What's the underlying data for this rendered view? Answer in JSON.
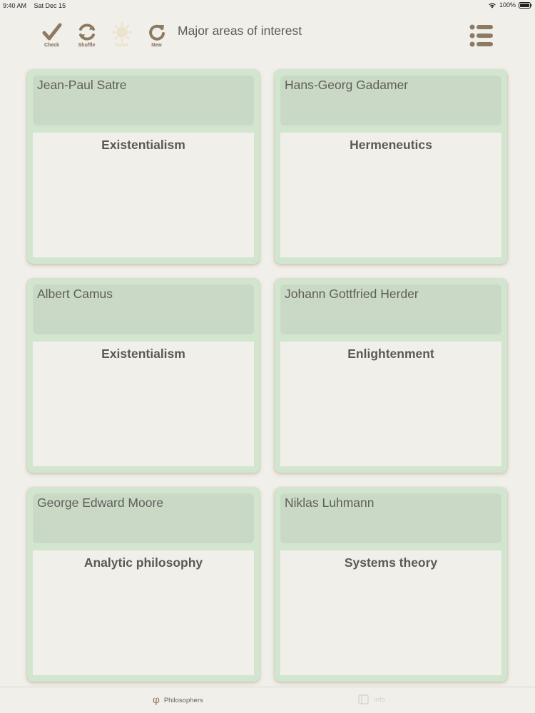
{
  "status_bar": {
    "time": "9:40 AM",
    "date": "Sat Dec 15",
    "battery": "100%"
  },
  "toolbar": {
    "check_label": "Check",
    "shuffle_label": "Shuffle",
    "solve_label": "Solve",
    "new_label": "New"
  },
  "page": {
    "title": "Major areas of interest"
  },
  "cards": [
    {
      "name": "Jean-Paul Satre",
      "area": "Existentialism"
    },
    {
      "name": "Hans-Georg Gadamer",
      "area": "Hermeneutics"
    },
    {
      "name": "Albert Camus",
      "area": "Existentialism"
    },
    {
      "name": "Johann Gottfried Herder",
      "area": "Enlightenment"
    },
    {
      "name": "George Edward Moore",
      "area": "Analytic philosophy"
    },
    {
      "name": "Niklas Luhmann",
      "area": "Systems theory"
    }
  ],
  "tabs": {
    "philosophers_label": "Philosophers",
    "philosophers_icon": "φ",
    "info_label": "Info"
  },
  "colors": {
    "background": "#f1efea",
    "card": "#d2e6cf",
    "card_header": "#cad9c6",
    "toolbar_icon": "#8c7a62"
  }
}
